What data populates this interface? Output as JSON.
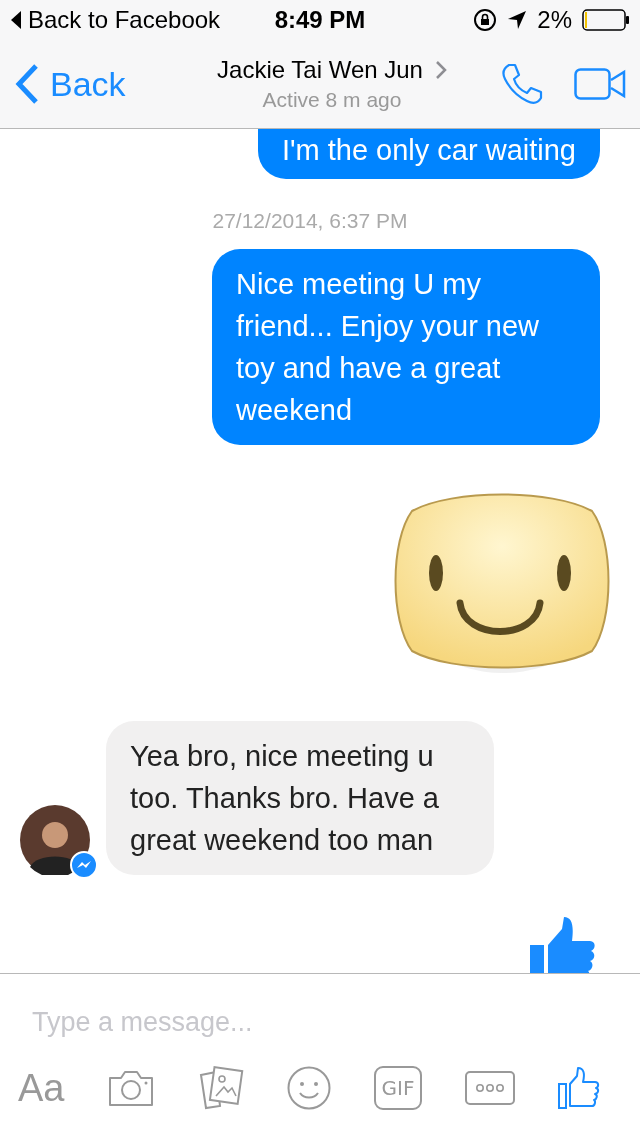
{
  "status_bar": {
    "back_app": "Back to Facebook",
    "time": "8:49 PM",
    "battery": "2%"
  },
  "header": {
    "back": "Back",
    "name": "Jackie Tai Wen Jun",
    "status": "Active 8 m ago"
  },
  "messages": [
    {
      "kind": "text",
      "outgoing": true,
      "text": "I'm the only car waiting"
    },
    {
      "kind": "timestamp",
      "text": "27/12/2014, 6:37 PM"
    },
    {
      "kind": "text",
      "outgoing": true,
      "text": "Nice meeting U my friend... Enjoy your new toy and have a great weekend"
    },
    {
      "kind": "sticker",
      "outgoing": true
    },
    {
      "kind": "text",
      "outgoing": false,
      "text": "Yea bro, nice meeting u too. Thanks bro. Have a great weekend too man"
    },
    {
      "kind": "like",
      "outgoing": true
    }
  ],
  "composer": {
    "placeholder": "Type a message..."
  },
  "tools": [
    {
      "kind": "text",
      "label": "Aa"
    },
    {
      "kind": "camera"
    },
    {
      "kind": "photos"
    },
    {
      "kind": "emoji"
    },
    {
      "kind": "gif",
      "label": "GIF"
    },
    {
      "kind": "more"
    },
    {
      "kind": "like"
    }
  ]
}
